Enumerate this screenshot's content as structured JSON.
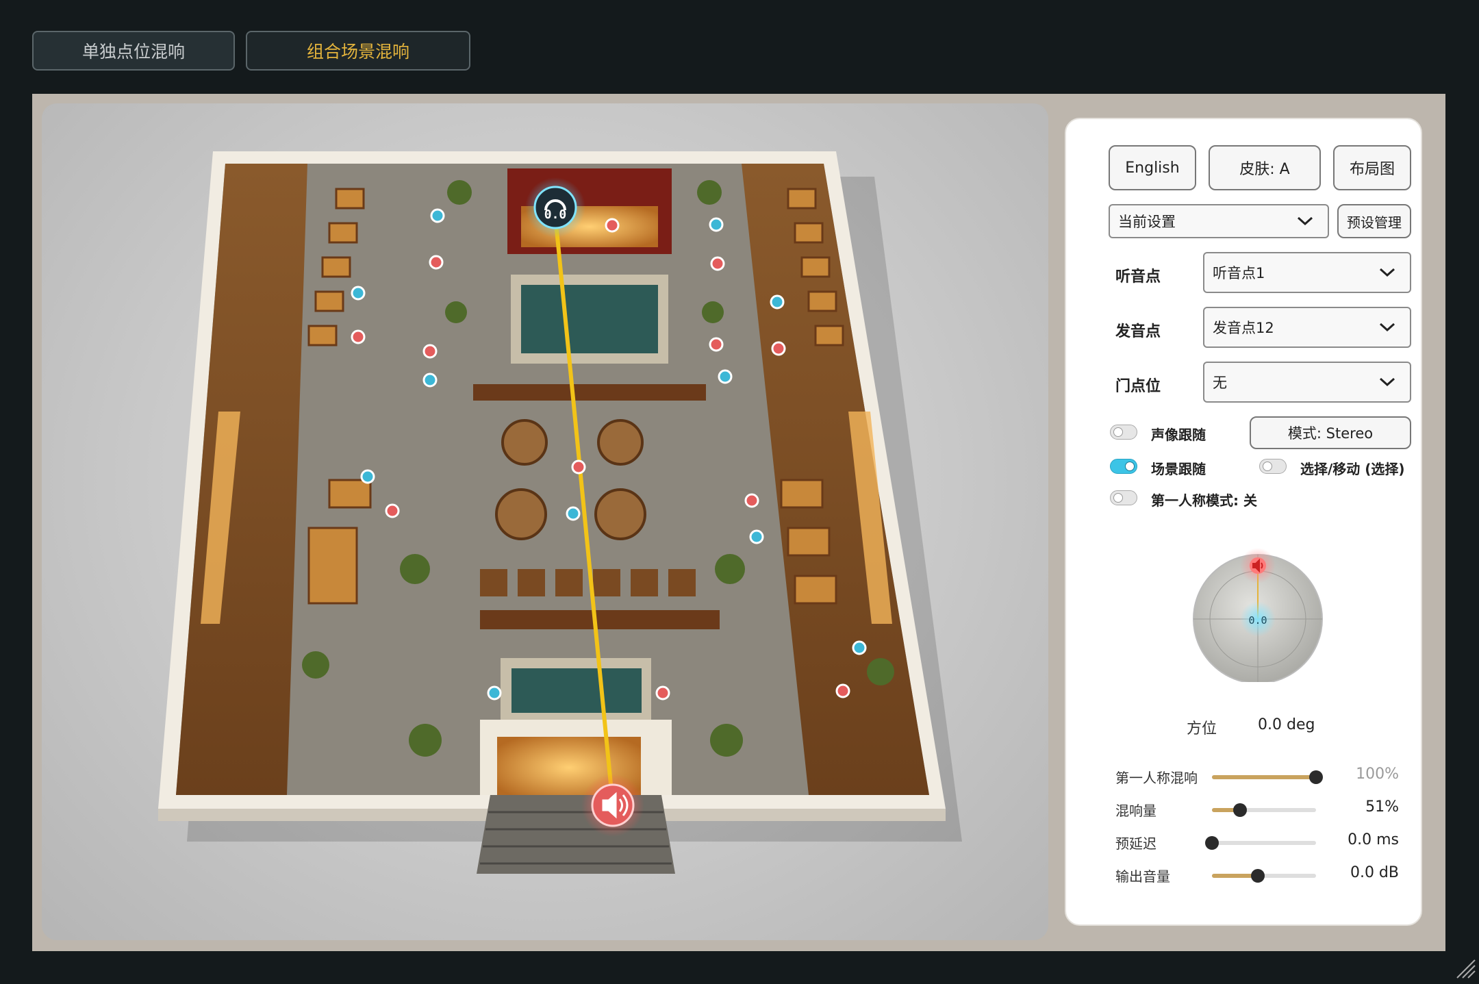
{
  "tabs": {
    "single": "单独点位混响",
    "combined": "组合场景混响"
  },
  "colors": {
    "accent_active_tab": "#e4b43c",
    "listener_blue": "#3cc4e6",
    "source_red": "#e45c5c",
    "sound_line": "#f2c318",
    "slider_fill": "#c9a35e"
  },
  "scene": {
    "listener_label": "0.0",
    "listener_icon": "headphones-icon",
    "source_icon": "speaker-icon"
  },
  "panel": {
    "language_button": "English",
    "skin_button": "皮肤: A",
    "layout_button": "布局图",
    "preset_select": "当前设置",
    "preset_manage_button": "预设管理",
    "listener": {
      "label": "听音点",
      "value": "听音点1"
    },
    "source": {
      "label": "发音点",
      "value": "发音点12"
    },
    "door": {
      "label": "门点位",
      "value": "无"
    },
    "toggles": {
      "image_follow": {
        "label": "声像跟随",
        "on": false
      },
      "scene_follow": {
        "label": "场景跟随",
        "on": true
      },
      "select_move": {
        "label": "选择/移动 (选择)",
        "on": false
      },
      "first_person": {
        "label": "第一人称模式: 关",
        "on": false
      }
    },
    "mode_button": "模式: Stereo",
    "radar": {
      "listener_label": "0.0"
    },
    "azimuth": {
      "label": "方位",
      "value": "0.0 deg"
    },
    "sliders": [
      {
        "label": "第一人称混响",
        "value": "100%",
        "level": 1.0,
        "dim": true
      },
      {
        "label": "混响量",
        "value": "51%",
        "level": 0.27,
        "dim": false
      },
      {
        "label": "预延迟",
        "value": "0.0 ms",
        "level": 0.0,
        "dim": false
      },
      {
        "label": "输出音量",
        "value": "0.0 dB",
        "level": 0.44,
        "dim": false
      }
    ]
  }
}
